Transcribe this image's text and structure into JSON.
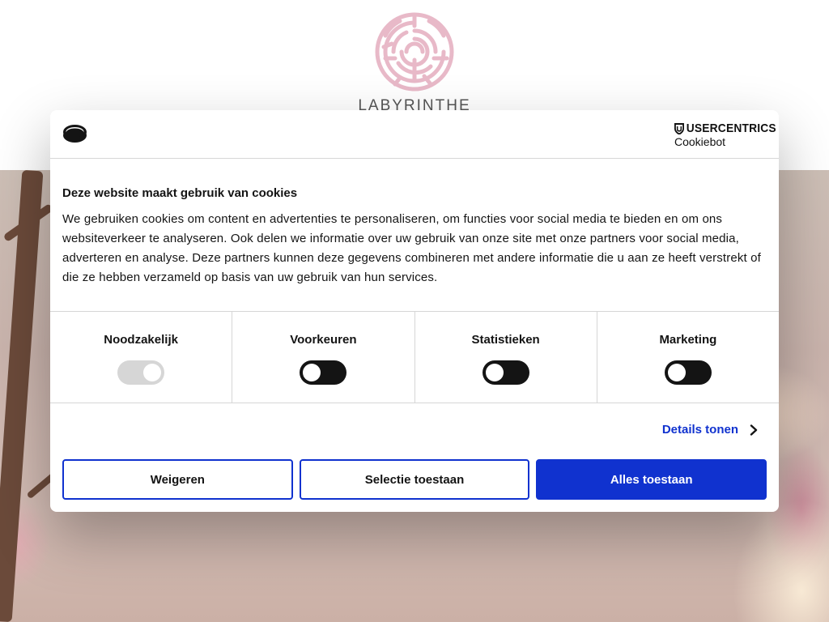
{
  "site": {
    "brand": "LABYRINTHE"
  },
  "cookie_banner": {
    "provider_name": "USERCENTRICS",
    "provider_product": "Cookiebot",
    "title": "Deze website maakt gebruik van cookies",
    "description": "We gebruiken cookies om content en advertenties te personaliseren, om functies voor social media te bieden en om ons websiteverkeer te analyseren. Ook delen we informatie over uw gebruik van onze site met onze partners voor social media, adverteren en analyse. Deze partners kunnen deze gegevens combineren met andere informatie die u aan ze heeft verstrekt of die ze hebben verzameld op basis van uw gebruik van hun services.",
    "categories": [
      {
        "label": "Noodzakelijk",
        "enabled": true,
        "locked": true
      },
      {
        "label": "Voorkeuren",
        "enabled": false,
        "locked": false
      },
      {
        "label": "Statistieken",
        "enabled": false,
        "locked": false
      },
      {
        "label": "Marketing",
        "enabled": false,
        "locked": false
      }
    ],
    "details_link": "Details tonen",
    "buttons": {
      "deny": "Weigeren",
      "allow_selection": "Selectie toestaan",
      "allow_all": "Alles toestaan"
    },
    "colors": {
      "accent": "#1032cf",
      "toggle_on": "#141414",
      "toggle_disabled": "#d6d6d6"
    }
  }
}
